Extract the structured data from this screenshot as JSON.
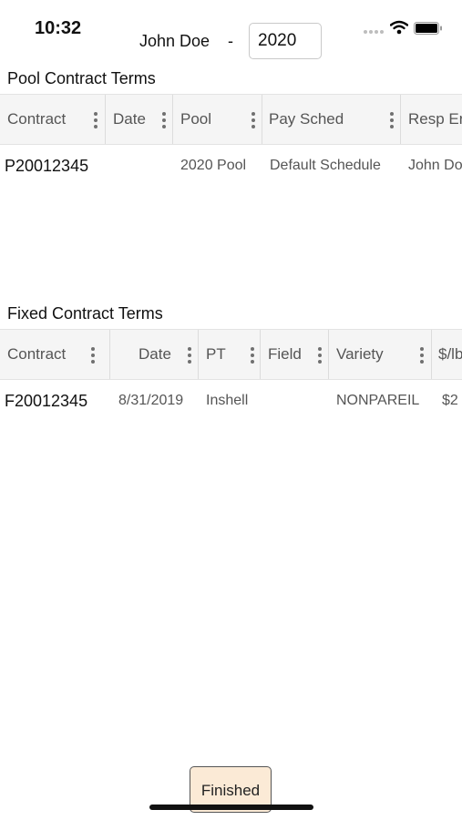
{
  "status_bar": {
    "time": "10:32"
  },
  "header": {
    "name": "John Doe",
    "separator": "-",
    "year": "2020"
  },
  "pool": {
    "title": "Pool Contract Terms",
    "columns": [
      "Contract",
      "Date",
      "Pool",
      "Pay Sched",
      "Resp Er"
    ],
    "rows": [
      {
        "contract": "P20012345",
        "date": "",
        "pool": "2020 Pool",
        "pay_sched": "Default Schedule",
        "resp": "John Do"
      }
    ]
  },
  "fixed": {
    "title": "Fixed Contract Terms",
    "columns": [
      "Contract",
      "Date",
      "PT",
      "Field",
      "Variety",
      "$/lb"
    ],
    "rows": [
      {
        "contract": "F20012345",
        "date": "8/31/2019",
        "pt": "Inshell",
        "field": "",
        "variety": "NONPAREIL",
        "price": "$2"
      }
    ]
  },
  "footer": {
    "finished_label": "Finished"
  }
}
